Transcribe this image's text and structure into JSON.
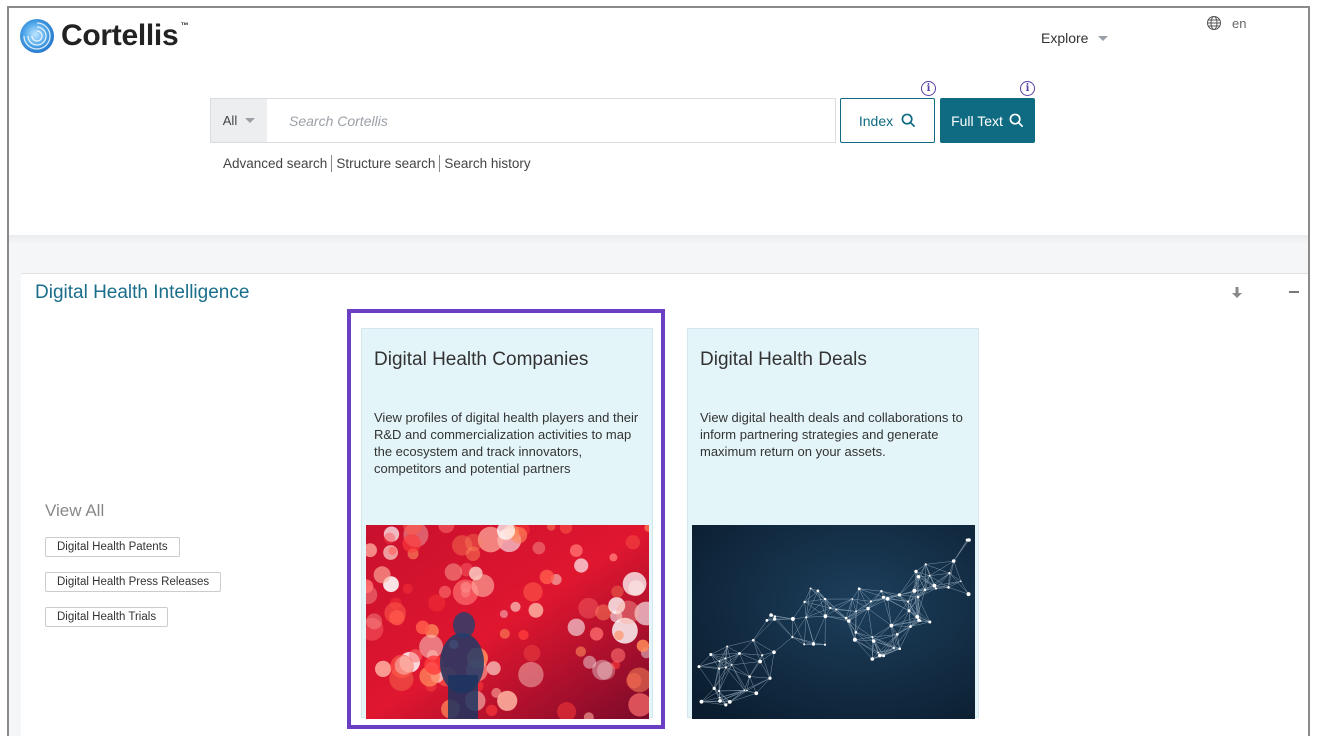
{
  "header": {
    "logo_text": "Cortellis",
    "logo_tm": "™",
    "explore_label": "Explore",
    "lang_label": "en"
  },
  "search": {
    "scope_label": "All",
    "placeholder": "Search Cortellis",
    "info_glyph": "i",
    "index_label": "Index",
    "fulltext_label": "Full Text",
    "links": [
      "Advanced search",
      "Structure search",
      "Search history"
    ]
  },
  "section": {
    "title": "Digital Health Intelligence",
    "view_all_label": "View All",
    "tags": [
      "Digital Health Patents",
      "Digital Health Press Releases",
      "Digital Health Trials"
    ],
    "cards": [
      {
        "title": "Digital Health Companies",
        "description": "View profiles of digital health players and their R&D and commercialization activities to map the ecosystem and track innovators, competitors and potential partners"
      },
      {
        "title": "Digital Health Deals",
        "description": "View digital health deals and collaborations to inform partnering strategies and generate maximum return on your assets."
      }
    ]
  },
  "colors": {
    "accent": "#0f6b82",
    "section_title": "#1a6e8a",
    "card_bg": "#e4f5fa",
    "highlight_border": "#6a3fc4"
  }
}
